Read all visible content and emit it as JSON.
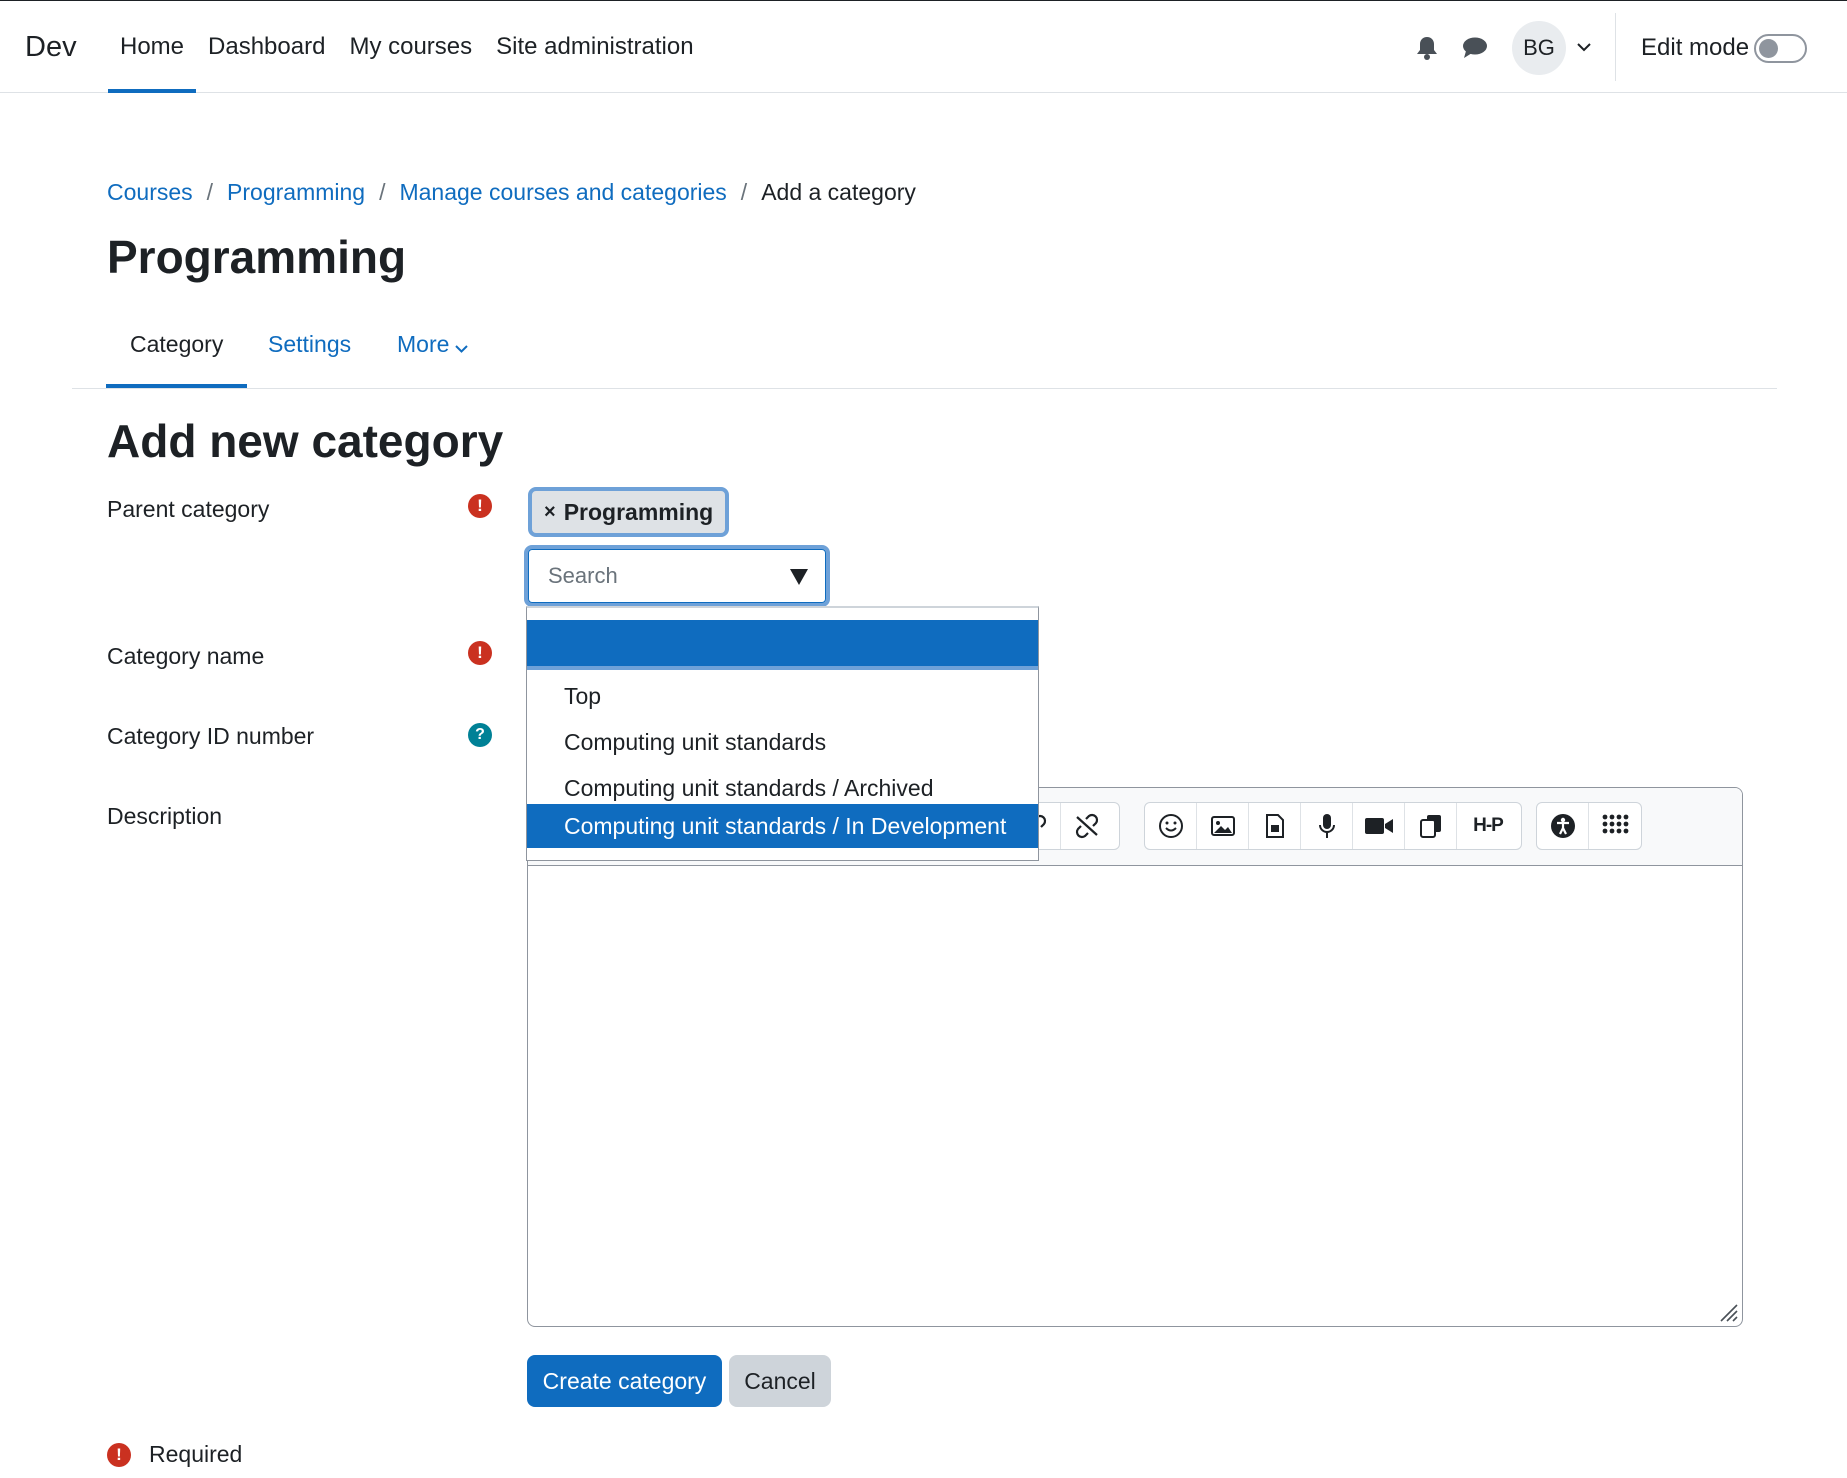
{
  "nav": {
    "brand": "Dev",
    "links": [
      "Home",
      "Dashboard",
      "My courses",
      "Site administration"
    ],
    "active_link": "Home",
    "avatar_initials": "BG",
    "edit_mode_label": "Edit mode",
    "edit_mode_on": false,
    "icons": [
      "bell-icon",
      "chat-icon",
      "chevron-down-icon"
    ]
  },
  "breadcrumb": {
    "items": [
      "Courses",
      "Programming",
      "Manage courses and categories"
    ],
    "current": "Add a category",
    "separator": "/"
  },
  "page": {
    "title": "Programming",
    "tabs": [
      "Category",
      "Settings",
      "More"
    ],
    "active_tab": "Category"
  },
  "form": {
    "title": "Add new category",
    "parent_label": "Parent category",
    "name_label": "Category name",
    "idnumber_label": "Category ID number",
    "description_label": "Description",
    "selected_parent": "Programming",
    "chip_remove": "×",
    "search_placeholder": "Search",
    "options": [
      "",
      "Top",
      "Computing unit standards",
      "Computing unit standards / Archived",
      "Computing unit standards / In Development"
    ],
    "highlighted_option": "Computing unit standards / In Development",
    "submit_label": "Create category",
    "cancel_label": "Cancel",
    "required_note": "Required",
    "required_symbol": "!",
    "help_symbol": "?"
  },
  "editor": {
    "toolbar_icons": [
      "link-icon",
      "unlink-icon",
      "emoji-icon",
      "image-icon",
      "media-icon",
      "record-audio-icon",
      "record-video-icon",
      "copy-icon",
      "h5p-icon",
      "accessibility-icon",
      "more-apps-icon"
    ],
    "h5p_label": "H-P"
  },
  "colors": {
    "primary": "#0f6cbf",
    "required": "#ca3120",
    "help": "#008196",
    "focus_ring": "#6ea1d8"
  }
}
